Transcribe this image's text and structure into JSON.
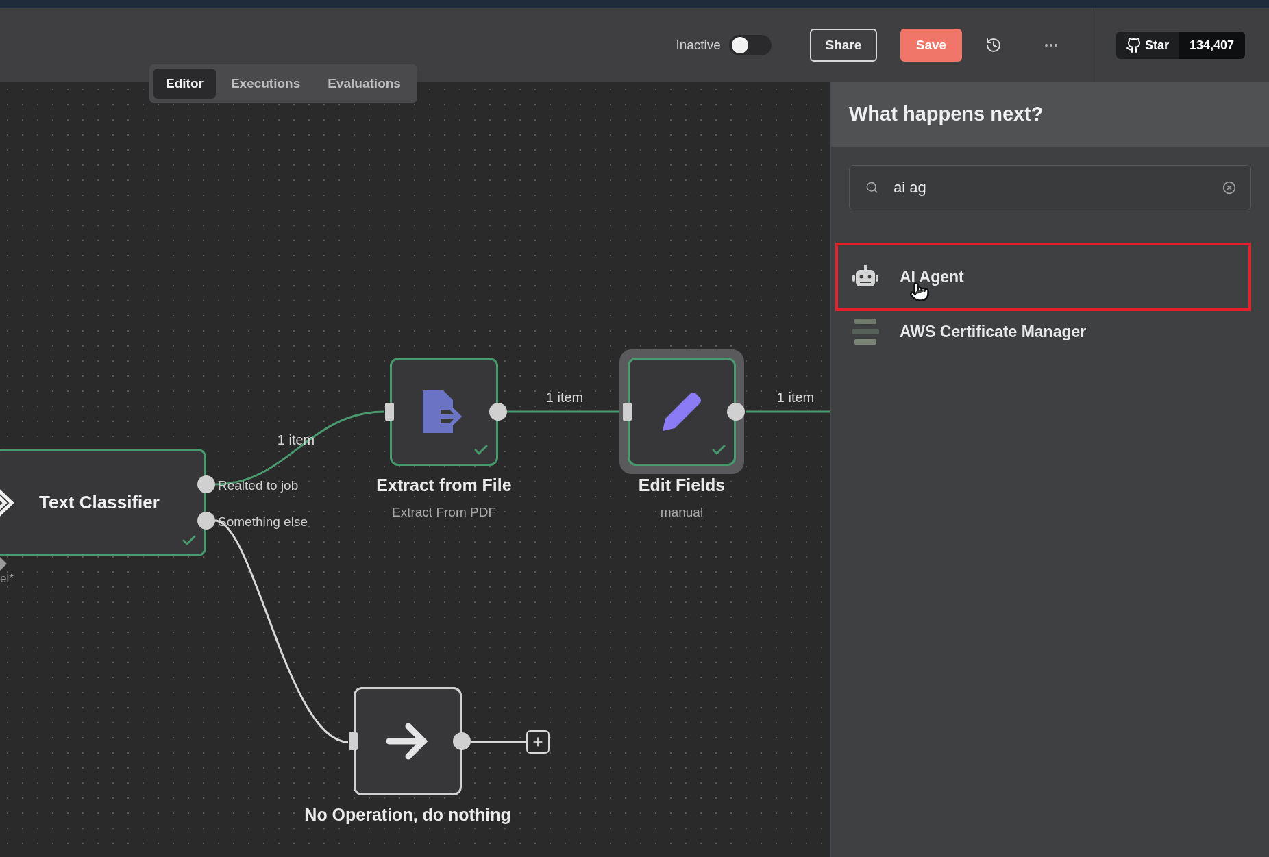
{
  "header": {
    "status_label": "Inactive",
    "active": false,
    "share": "Share",
    "save": "Save",
    "github": {
      "star": "Star",
      "count": "134,407"
    }
  },
  "tabs": [
    {
      "label": "Editor",
      "selected": true
    },
    {
      "label": "Executions",
      "selected": false
    },
    {
      "label": "Evaluations",
      "selected": false
    }
  ],
  "canvas": {
    "nodes": [
      {
        "name": "Text Classifier",
        "kind": "classifier",
        "success": true,
        "selected": false,
        "outputs": [
          "Realted to job",
          "Something else"
        ]
      },
      {
        "name": "Extract from File",
        "subtitle": "Extract From PDF",
        "kind": "file",
        "success": true,
        "selected": false
      },
      {
        "name": "Edit Fields",
        "subtitle": "manual",
        "kind": "pencil",
        "success": true,
        "selected": true
      },
      {
        "name": "No Operation, do nothing",
        "kind": "arrow",
        "success": false,
        "selected": false
      }
    ],
    "edge_labels": [
      "1 item",
      "1 item",
      "1 item"
    ],
    "partial_label": "el*"
  },
  "panel": {
    "title": "What happens next?",
    "search": {
      "value": "ai ag"
    },
    "results": [
      {
        "label": "AI Agent",
        "kind": "robot",
        "selected": true
      },
      {
        "label": "AWS Certificate Manager",
        "kind": "stack",
        "selected": false
      }
    ]
  }
}
